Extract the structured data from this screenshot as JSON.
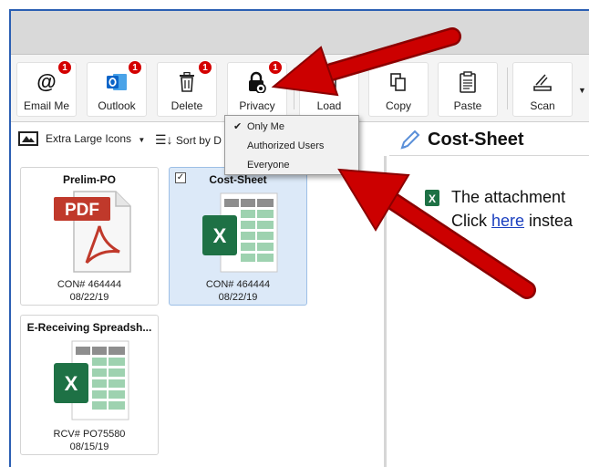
{
  "toolbar": {
    "buttons": [
      {
        "label": "Email Me",
        "icon": "at-icon",
        "badge": "1"
      },
      {
        "label": "Outlook",
        "icon": "outlook-icon",
        "badge": "1"
      },
      {
        "label": "Delete",
        "icon": "trash-icon",
        "badge": "1"
      },
      {
        "label": "Privacy",
        "icon": "lock-icon",
        "badge": "1"
      },
      {
        "label": "Load",
        "icon": "load-icon"
      },
      {
        "label": "Copy",
        "icon": "copy-icon"
      },
      {
        "label": "Paste",
        "icon": "clipboard-icon"
      },
      {
        "label": "Scan",
        "icon": "scanner-icon"
      }
    ]
  },
  "privacy_menu": {
    "items": [
      {
        "label": "Only Me",
        "checked": true
      },
      {
        "label": "Authorized Users",
        "checked": false
      },
      {
        "label": "Everyone",
        "checked": false
      }
    ]
  },
  "view_bar": {
    "view_mode": "Extra Large Icons",
    "sort_label": "Sort by D"
  },
  "files": [
    {
      "title": "Prelim-PO",
      "type": "pdf",
      "ref": "CON# 464444",
      "date": "08/22/19",
      "selected": false,
      "icon_text": "PDF"
    },
    {
      "title": "Cost-Sheet",
      "type": "excel",
      "ref": "CON# 464444",
      "date": "08/22/19",
      "selected": true,
      "icon_text": "X"
    },
    {
      "title": "E-Receiving Spreadsh...",
      "type": "excel",
      "ref": "RCV# PO75580",
      "date": "08/15/19",
      "selected": false,
      "icon_text": "X"
    }
  ],
  "preview": {
    "title": "Cost-Sheet",
    "line1": "The attachment",
    "line2_prefix": "Click ",
    "line2_link": "here",
    "line2_suffix": " instea"
  },
  "colors": {
    "badge": "#d40000",
    "arrow": "#cc0000",
    "excel_green": "#1e7145",
    "pdf_red": "#c0392b",
    "link": "#1a3fbf",
    "selection": "#dce9f8"
  }
}
